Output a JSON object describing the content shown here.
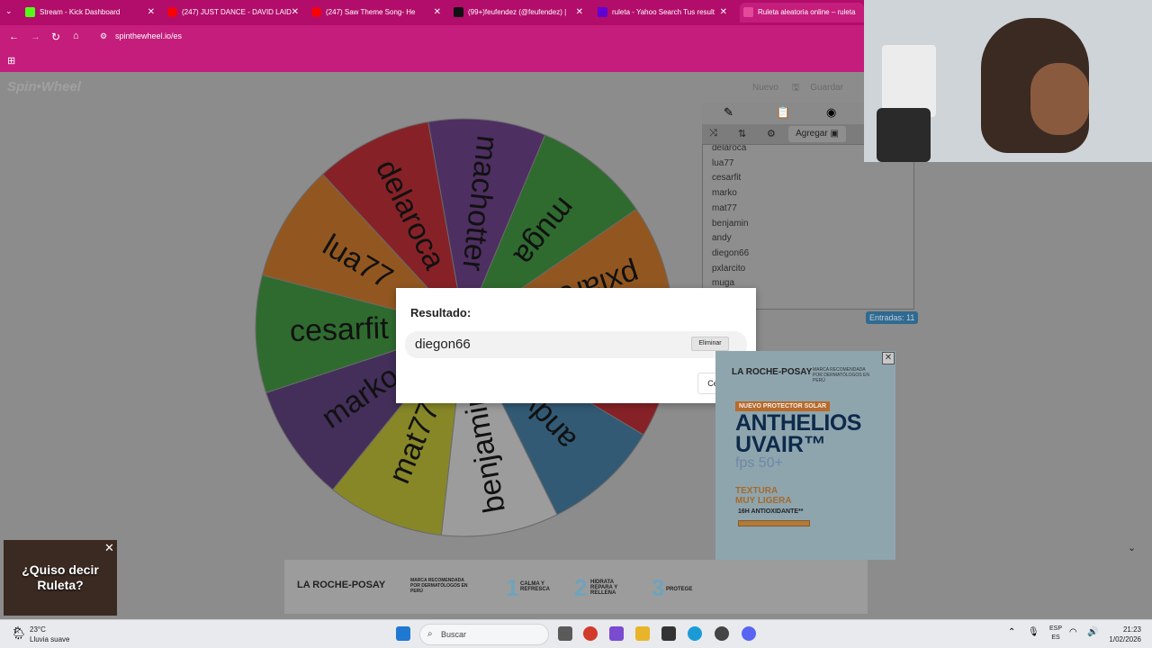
{
  "browser": {
    "tabs": [
      {
        "label": "Stream - Kick Dashboard",
        "icon": "kick-icon",
        "color": "#53fc18"
      },
      {
        "label": "(247) JUST DANCE - DAVID LAID",
        "icon": "youtube-icon",
        "color": "#ff0000"
      },
      {
        "label": "(247) Saw Theme Song- He",
        "icon": "youtube-icon",
        "color": "#ff0000"
      },
      {
        "label": "(99+)feufendez (@feufendez) |",
        "icon": "tiktok-icon",
        "color": "#000000"
      },
      {
        "label": "ruleta - Yahoo Search Tus result",
        "icon": "yahoo-icon",
        "color": "#6001d2"
      },
      {
        "label": "Ruleta aleatoria online – ruleta",
        "icon": "spinthewheel-icon",
        "color": "#e34b9a"
      }
    ],
    "url": "spinthewheel.io/es"
  },
  "site": {
    "logo": "Spin•Wheel",
    "new_label": "Nuevo",
    "save_label": "Guardar"
  },
  "panel": {
    "add_label": "Agregar",
    "entries": [
      "delaroca",
      "lua77",
      "cesarfit",
      "marko",
      "mat77",
      "benjamin",
      "andy",
      "diegon66",
      "pxlarcito",
      "muga"
    ],
    "entries_count": "Entradas: 11"
  },
  "wheel": {
    "segments": [
      {
        "name": "machotter",
        "color": "#5b2a7a"
      },
      {
        "name": "muga",
        "color": "#2a8a2a"
      },
      {
        "name": "pxlarcito",
        "color": "#c96a12"
      },
      {
        "name": "diegon66",
        "color": "#b5141c"
      },
      {
        "name": "andy",
        "color": "#2f6f9a"
      },
      {
        "name": "benjamin",
        "color": "#d9d9d9"
      },
      {
        "name": "mat77",
        "color": "#b8b81e"
      },
      {
        "name": "marko",
        "color": "#4a2a6e"
      },
      {
        "name": "cesarfit",
        "color": "#2a8a2a"
      },
      {
        "name": "lua77",
        "color": "#c96a12"
      },
      {
        "name": "delaroca",
        "color": "#b5141c"
      }
    ]
  },
  "dialog": {
    "title": "Resultado:",
    "result": "diegon66",
    "remove_label": "Eliminar",
    "close_label": "Cerrar"
  },
  "ad_right": {
    "brand": "LA ROCHE-POSAY",
    "recommend": "MARCA RECOMENDADA POR DERMATÓLOGOS EN PERÚ",
    "tag": "NUEVO PROTECTOR SOLAR",
    "headline1": "ANTHELIOS",
    "headline2": "UVAIR™",
    "fps": "fps 50+",
    "texture": "TEXTURA MUY LIGERA",
    "antiox": "16H ANTIOXIDANTE**"
  },
  "ad_bottom": {
    "brand": "LA ROCHE-POSAY",
    "recommend": "MARCA RECOMENDADA POR DERMATÓLOGOS EN PERÚ",
    "step1": "CALMA Y REFRESCA",
    "step2": "HIDRATA REPARA Y RELLENA",
    "step3": "PROTEGE"
  },
  "thumb": {
    "text": "¿Quiso decir Ruleta?"
  },
  "taskbar": {
    "temperature": "23°C",
    "weather": "Lluvia suave",
    "search_label": "Buscar",
    "lang1": "ESP",
    "lang2": "ES",
    "time": "21:23",
    "date": "1/02/2026"
  }
}
